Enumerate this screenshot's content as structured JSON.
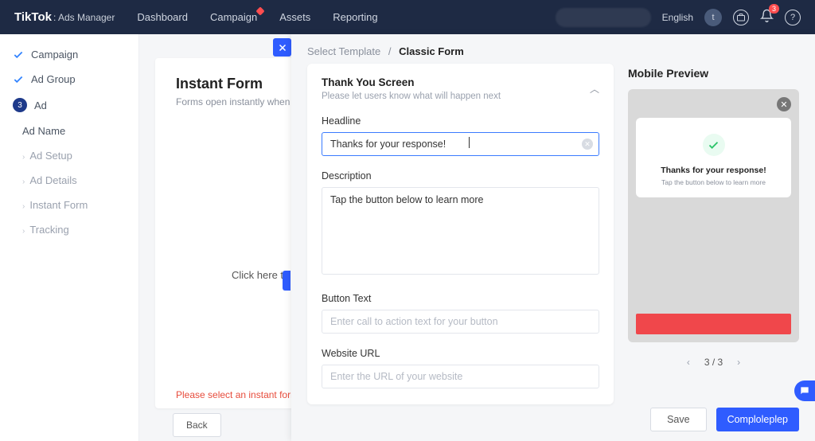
{
  "topbar": {
    "brand": "TikTok",
    "brand_sub": ": Ads Manager",
    "nav": [
      "Dashboard",
      "Campaign",
      "Assets",
      "Reporting"
    ],
    "language": "English",
    "avatar_letter": "t",
    "bell_count": "3"
  },
  "sidebar": {
    "steps": [
      {
        "label": "Campaign",
        "done": true
      },
      {
        "label": "Ad Group",
        "done": true
      },
      {
        "label": "Ad",
        "num": "3"
      }
    ],
    "subs": [
      "Ad Name",
      "Ad Setup",
      "Ad Details",
      "Instant Form",
      "Tracking"
    ]
  },
  "bgcard": {
    "title": "Instant Form",
    "sub": "Forms open instantly when someone",
    "click_hint": "Click here to c",
    "error": "Please select an instant form in o",
    "back": "Back"
  },
  "panel": {
    "crumb_prev": "Select Template",
    "crumb_cur": "Classic Form",
    "section_title": "Thank You Screen",
    "section_sub": "Please let users know what will happen next",
    "fields": {
      "headline_label": "Headline",
      "headline_value": "Thanks for your response!",
      "description_label": "Description",
      "description_value": "Tap the button below to learn more",
      "button_label": "Button Text",
      "button_placeholder": "Enter call to action text for your button",
      "url_label": "Website URL",
      "url_placeholder": "Enter the URL of your website"
    },
    "footer": {
      "save": "Save",
      "complete": "Comploleplep"
    }
  },
  "preview": {
    "title": "Mobile Preview",
    "headline": "Thanks for your response!",
    "desc": "Tap the button below to learn more",
    "page": "3 / 3"
  }
}
